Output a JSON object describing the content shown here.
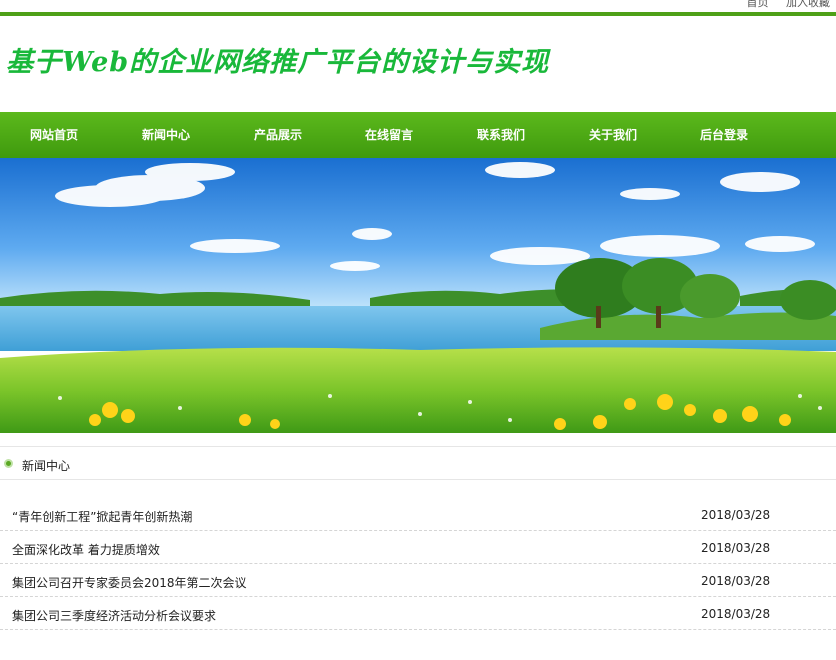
{
  "topbar": {
    "link1": "首页",
    "link2": "加入收藏"
  },
  "header": {
    "title": "基于Web的企业网络推广平台的设计与实现"
  },
  "nav": {
    "items": [
      "网站首页",
      "新闻中心",
      "产品展示",
      "在线留言",
      "联系我们",
      "关于我们",
      "后台登录"
    ]
  },
  "news": {
    "heading": "新闻中心",
    "items": [
      {
        "title": "“青年创新工程”掀起青年创新热潮",
        "date": "2018/03/28"
      },
      {
        "title": "全面深化改革 着力提质增效",
        "date": "2018/03/28"
      },
      {
        "title": "集团公司召开专家委员会2018年第二次会议",
        "date": "2018/03/28"
      },
      {
        "title": "集团公司三季度经济活动分析会议要求",
        "date": "2018/03/28"
      }
    ]
  },
  "colors": {
    "nav_green": "#4ea018",
    "title_green": "#19b83a"
  }
}
